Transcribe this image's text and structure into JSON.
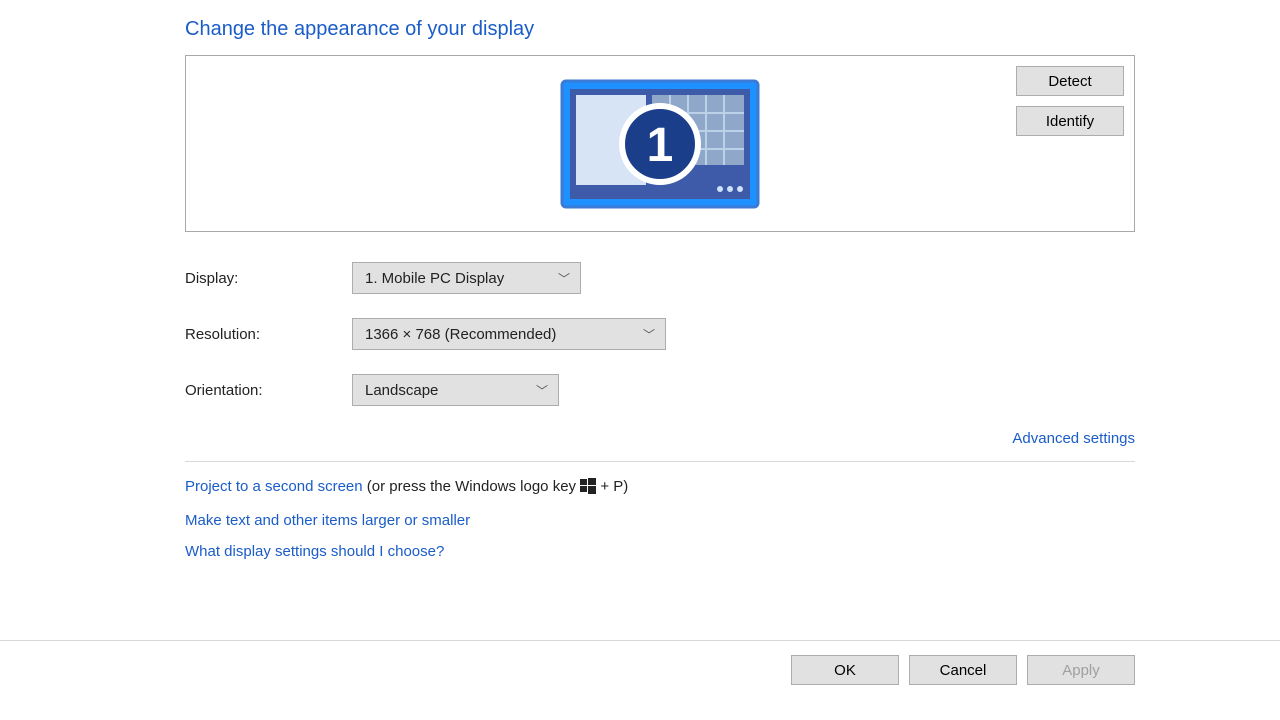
{
  "title": "Change the appearance of your display",
  "preview": {
    "detect_label": "Detect",
    "identify_label": "Identify",
    "monitor_number": "1"
  },
  "fields": {
    "display": {
      "label": "Display:",
      "value": "1. Mobile PC Display"
    },
    "resolution": {
      "label": "Resolution:",
      "value": "1366 × 768 (Recommended)"
    },
    "orientation": {
      "label": "Orientation:",
      "value": "Landscape"
    }
  },
  "advanced_link": "Advanced settings",
  "helpers": {
    "project_link": "Project to a second screen",
    "project_suffix_before": " (or press the Windows logo key ",
    "project_suffix_after": " + P)",
    "text_size_link": "Make text and other items larger or smaller",
    "which_link": "What display settings should I choose?"
  },
  "footer": {
    "ok": "OK",
    "cancel": "Cancel",
    "apply": "Apply"
  }
}
